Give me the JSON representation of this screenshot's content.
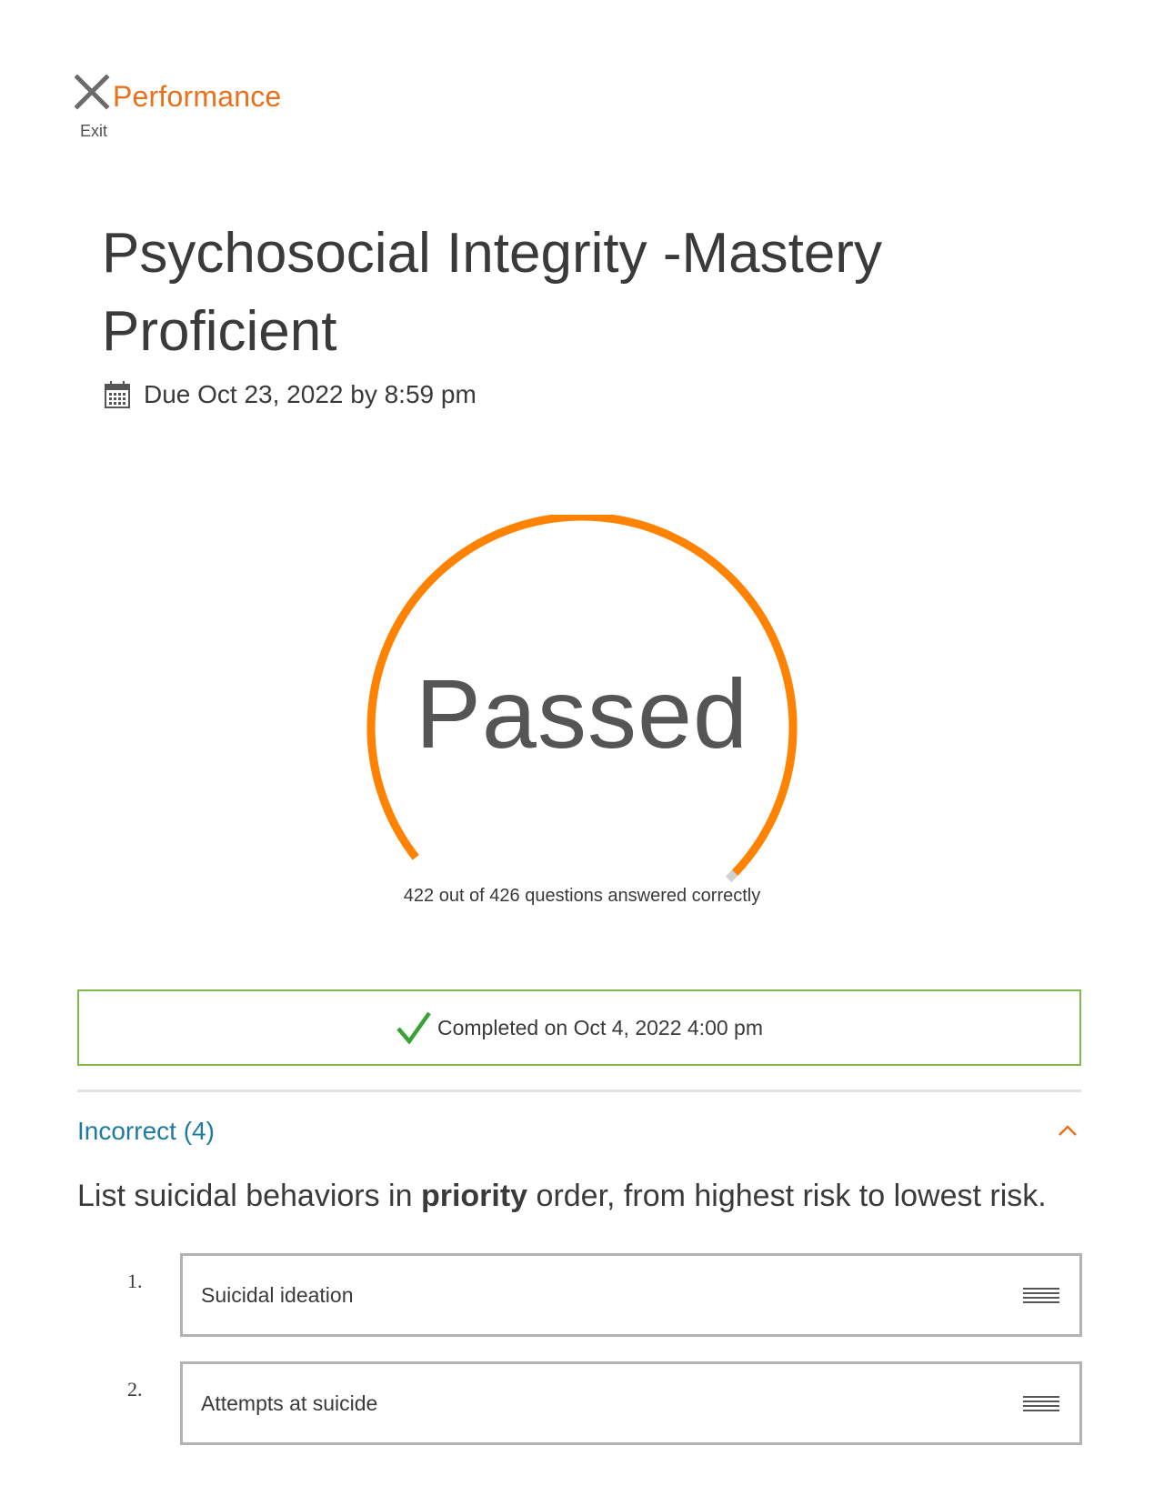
{
  "header": {
    "title": "Performance",
    "exit_label": "Exit"
  },
  "assignment": {
    "title": "Psychosocial Integrity -Mastery Proficient",
    "due": "Due Oct 23, 2022 by 8:59 pm"
  },
  "gauge": {
    "result": "Passed",
    "caption": "422 out of 426 questions answered correctly",
    "correct": 422,
    "total": 426,
    "color": "#ff8200"
  },
  "completed": {
    "text": "Completed on Oct 4, 2022 4:00 pm",
    "border_color": "#7fba4a",
    "check_color": "#3aa335"
  },
  "incorrect_section": {
    "title": "Incorrect (4)",
    "expanded": true,
    "question_before": "List suicidal behaviors in ",
    "question_bold": "priority",
    "question_after": " order, from highest risk to lowest risk.",
    "answers": [
      {
        "number": "1.",
        "text": "Suicidal ideation"
      },
      {
        "number": "2.",
        "text": "Attempts at suicide"
      }
    ]
  },
  "colors": {
    "accent": "#e9711c",
    "link": "#1f7a9e"
  }
}
